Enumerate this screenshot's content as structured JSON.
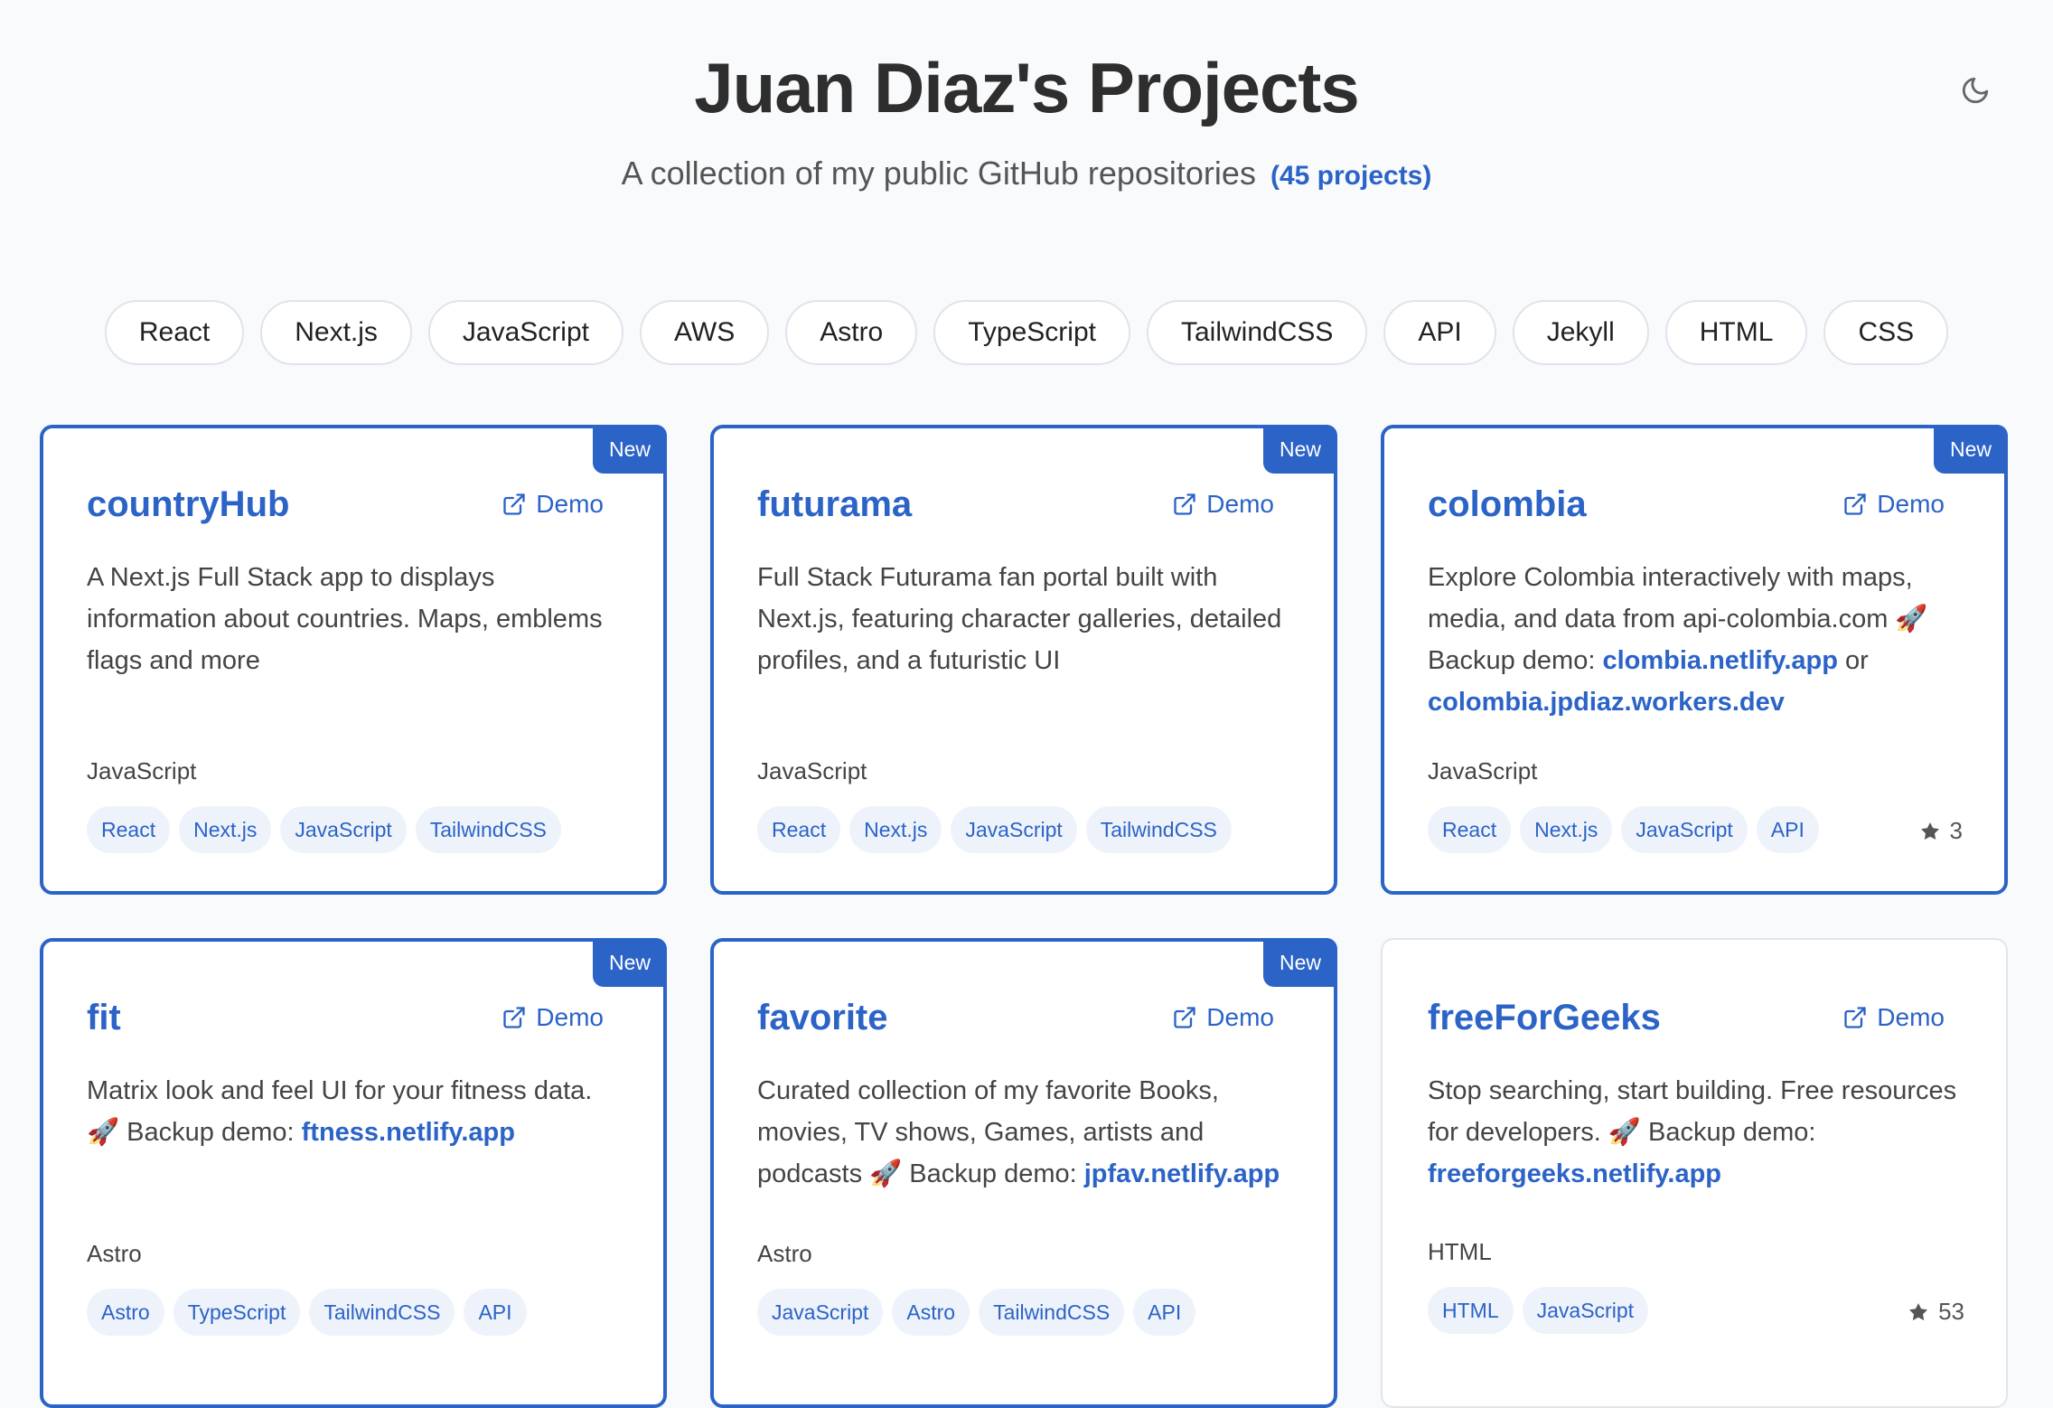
{
  "header": {
    "title": "Juan Diaz's Projects",
    "subtitle": "A collection of my public GitHub repositories",
    "count": "(45 projects)",
    "theme_icon": "moon-icon"
  },
  "filters": [
    "React",
    "Next.js",
    "JavaScript",
    "AWS",
    "Astro",
    "TypeScript",
    "TailwindCSS",
    "API",
    "Jekyll",
    "HTML",
    "CSS"
  ],
  "colors": {
    "accent": "#2b63c7",
    "background": "#f8fafc",
    "tag_bg": "#eef3fb"
  },
  "projects": [
    {
      "name": "countryHub",
      "badge": "New",
      "demo_label": "Demo",
      "description": "A Next.js Full Stack app to displays information about countries. Maps, emblems flags and more",
      "language": "JavaScript",
      "tags": [
        "React",
        "Next.js",
        "JavaScript",
        "TailwindCSS"
      ]
    },
    {
      "name": "futurama",
      "badge": "New",
      "demo_label": "Demo",
      "description": "Full Stack Futurama fan portal built with Next.js, featuring character galleries, detailed profiles, and a futuristic UI",
      "language": "JavaScript",
      "tags": [
        "React",
        "Next.js",
        "JavaScript",
        "TailwindCSS"
      ]
    },
    {
      "name": "colombia",
      "badge": "New",
      "demo_label": "Demo",
      "description": "Explore Colombia interactively with maps, media, and data from api-colombia.com 🚀 Backup demo:",
      "link1": "clombia.netlify.app",
      "link_sep": "or",
      "link2": "colombia.jpdiaz.workers.dev",
      "language": "JavaScript",
      "tags": [
        "React",
        "Next.js",
        "JavaScript",
        "API"
      ],
      "stars": "3"
    },
    {
      "name": "fit",
      "badge": "New",
      "demo_label": "Demo",
      "description": "Matrix look and feel UI for your fitness data. 🚀 Backup demo:",
      "link1": "ftness.netlify.app",
      "language": "Astro",
      "tags": [
        "Astro",
        "TypeScript",
        "TailwindCSS",
        "API"
      ]
    },
    {
      "name": "favorite",
      "badge": "New",
      "demo_label": "Demo",
      "description": "Curated collection of my favorite Books, movies, TV shows, Games, artists and podcasts 🚀 Backup demo:",
      "link1": "jpfav.netlify.app",
      "language": "Astro",
      "tags": [
        "JavaScript",
        "Astro",
        "TailwindCSS",
        "API"
      ]
    },
    {
      "name": "freeForGeeks",
      "demo_label": "Demo",
      "description": "Stop searching, start building. Free resources for developers. 🚀 Backup demo:",
      "link1": "freeforgeeks.netlify.app",
      "language": "HTML",
      "tags": [
        "HTML",
        "JavaScript"
      ],
      "stars": "53"
    }
  ]
}
